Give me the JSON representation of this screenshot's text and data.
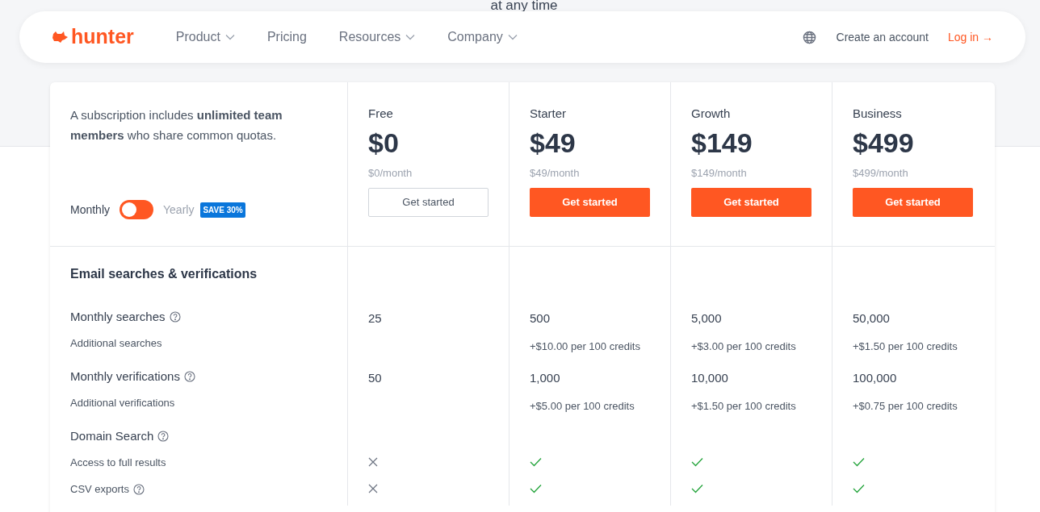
{
  "hero_tail": "at any time",
  "nav": {
    "logo": "hunter",
    "items": [
      {
        "label": "Product",
        "dropdown": true
      },
      {
        "label": "Pricing",
        "dropdown": false
      },
      {
        "label": "Resources",
        "dropdown": true
      },
      {
        "label": "Company",
        "dropdown": true
      }
    ],
    "create_account": "Create an account",
    "login": "Log in →"
  },
  "intro": "A subscription includes **unlimited team members** who share common quotas.",
  "billing": {
    "monthly": "Monthly",
    "yearly": "Yearly",
    "yearly_selected": false,
    "badge": "SAVE 30%"
  },
  "plans": [
    {
      "name": "Free",
      "price": "$0",
      "per_month": "$0/month",
      "cta": "Get started",
      "primary": false
    },
    {
      "name": "Starter",
      "price": "$49",
      "per_month": "$49/month",
      "cta": "Get started",
      "primary": true
    },
    {
      "name": "Growth",
      "price": "$149",
      "per_month": "$149/month",
      "cta": "Get started",
      "primary": true
    },
    {
      "name": "Business",
      "price": "$499",
      "per_month": "$499/month",
      "cta": "Get started",
      "primary": true
    }
  ],
  "section_title": "Email searches & verifications",
  "rows": [
    {
      "kind": "main",
      "label": "Monthly searches",
      "help": true,
      "cells": [
        "25",
        "500",
        "5,000",
        "50,000"
      ]
    },
    {
      "kind": "sub",
      "label": "Additional searches",
      "help": false,
      "cells": [
        "",
        "+$10.00 per 100 credits",
        "+$3.00 per 100 credits",
        "+$1.50 per 100 credits"
      ]
    },
    {
      "kind": "main",
      "label": "Monthly verifications",
      "help": true,
      "cells": [
        "50",
        "1,000",
        "10,000",
        "100,000"
      ]
    },
    {
      "kind": "sub",
      "label": "Additional verifications",
      "help": false,
      "cells": [
        "",
        "+$5.00 per 100 credits",
        "+$1.50 per 100 credits",
        "+$0.75 per 100 credits"
      ]
    },
    {
      "kind": "main",
      "label": "Domain Search",
      "help": true,
      "cells": []
    },
    {
      "kind": "sub",
      "label": "Access to full results",
      "help": false,
      "included": [
        false,
        true,
        true,
        true
      ]
    },
    {
      "kind": "sub",
      "label": "CSV exports",
      "help": true,
      "included": [
        false,
        true,
        true,
        true
      ]
    }
  ]
}
